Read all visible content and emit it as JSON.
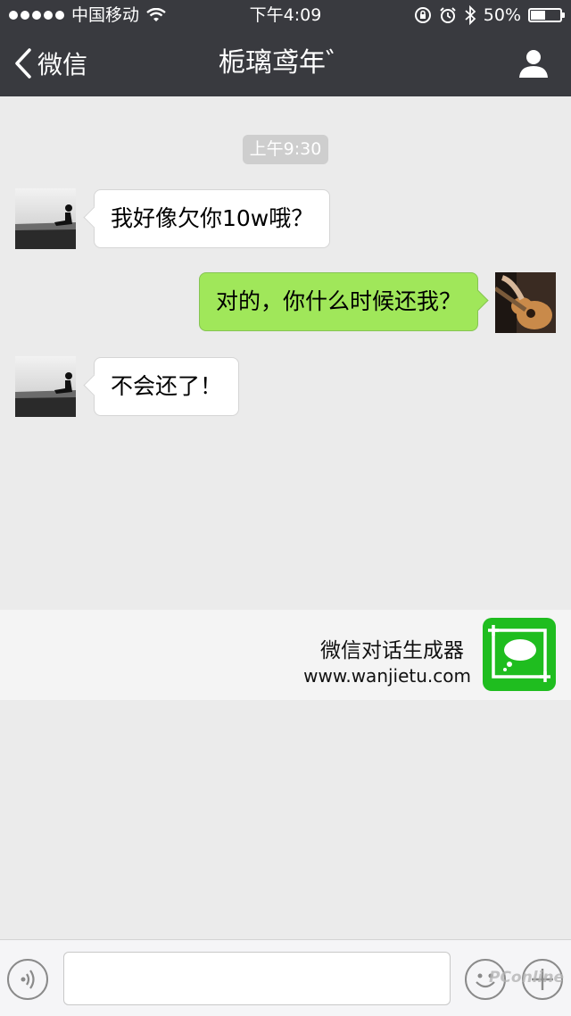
{
  "status_bar": {
    "carrier": "中国移动",
    "time": "下午4:09",
    "battery_percent": "50%",
    "battery_level": 0.5
  },
  "nav": {
    "back_label": "微信",
    "title": "栀璃鸢年゛"
  },
  "chat": {
    "timestamp": "上午9:30",
    "messages": [
      {
        "side": "left",
        "text": "我好像欠你10w哦？"
      },
      {
        "side": "right",
        "text": "对的，你什么时候还我？"
      },
      {
        "side": "left",
        "text": "不会还了！"
      }
    ]
  },
  "banner": {
    "title": "微信对话生成器",
    "url": "www.wanjietu.com"
  },
  "input_bar": {
    "value": ""
  },
  "watermark": "PConline",
  "colors": {
    "header_bg": "#393a3f",
    "chat_bg": "#ebebeb",
    "sent_bubble": "#a0e75a",
    "received_bubble": "#ffffff",
    "logo_green": "#1fbd1f"
  },
  "icons": [
    "wifi-icon",
    "lock-rotation-icon",
    "alarm-icon",
    "bluetooth-icon",
    "battery-icon",
    "back-chevron-icon",
    "profile-icon",
    "voice-icon",
    "emoji-icon",
    "plus-icon",
    "chat-generator-logo"
  ]
}
